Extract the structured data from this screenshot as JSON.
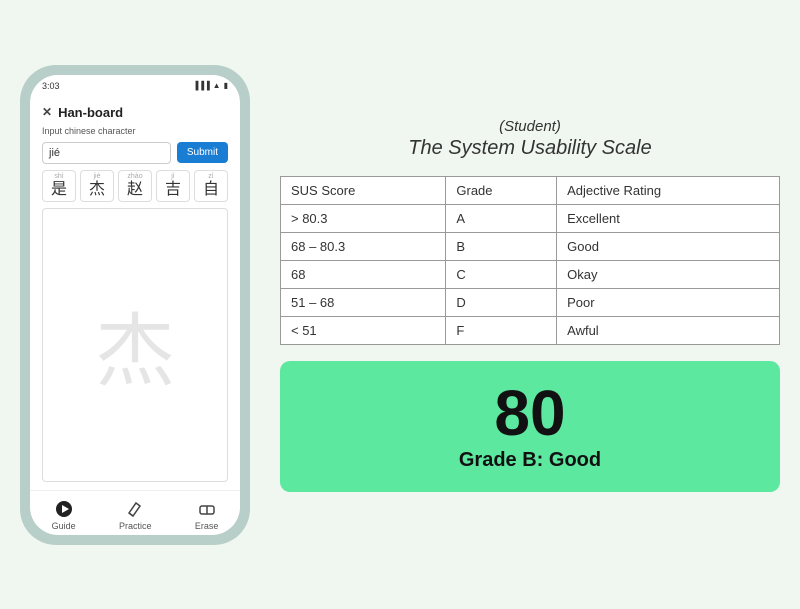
{
  "phone": {
    "status_time": "3:03",
    "app_title": "Han-board",
    "input_label": "Input chinese character",
    "input_value": "jié",
    "submit_label": "Submit",
    "characters": [
      {
        "pinyin": "shì",
        "hanzi": "是"
      },
      {
        "pinyin": "jié",
        "hanzi": "杰"
      },
      {
        "pinyin": "zhào",
        "hanzi": "赵"
      },
      {
        "pinyin": "jí",
        "hanzi": "吉"
      },
      {
        "pinyin": "zì",
        "hanzi": "自"
      }
    ],
    "display_char": "杰",
    "nav_items": [
      {
        "label": "Guide",
        "icon": "play"
      },
      {
        "label": "Practice",
        "icon": "pencil"
      },
      {
        "label": "Erase",
        "icon": "eraser"
      }
    ]
  },
  "sus": {
    "subtitle": "(Student)",
    "main_title": "The System Usability Scale",
    "table": {
      "headers": [
        "SUS Score",
        "Grade",
        "Adjective Rating"
      ],
      "rows": [
        [
          "> 80.3",
          "A",
          "Excellent"
        ],
        [
          "68 – 80.3",
          "B",
          "Good"
        ],
        [
          "68",
          "C",
          "Okay"
        ],
        [
          "51 – 68",
          "D",
          "Poor"
        ],
        [
          "< 51",
          "F",
          "Awful"
        ]
      ]
    },
    "score": "80",
    "grade_label": "Grade B: Good",
    "score_bg": "#5de8a0"
  }
}
